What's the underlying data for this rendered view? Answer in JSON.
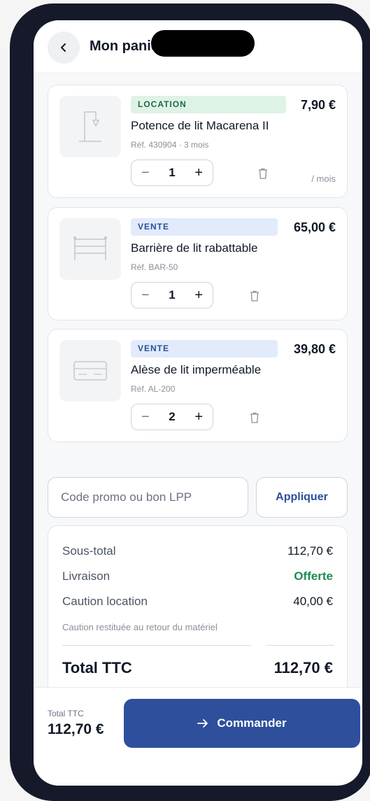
{
  "header": {
    "title": "Mon panier",
    "back_icon": "chevron-left-icon"
  },
  "items": [
    {
      "badge": "LOCATION",
      "badge_type": "location",
      "price": "7,90 €",
      "name": "Potence de lit Macarena II",
      "ref": "Réf. 430904 · 3 mois",
      "qty": "1",
      "period": "/ mois",
      "icon": "bed-pole-icon"
    },
    {
      "badge": "VENTE",
      "badge_type": "vente",
      "price": "65,00 €",
      "name": "Barrière de lit rabattable",
      "ref": "Réf. BAR-50",
      "qty": "1",
      "period": "",
      "icon": "bed-rail-icon"
    },
    {
      "badge": "VENTE",
      "badge_type": "vente",
      "price": "39,80 €",
      "name": "Alèse de lit imperméable",
      "ref": "Réf. AL-200",
      "qty": "2",
      "period": "",
      "icon": "mattress-protector-icon"
    }
  ],
  "promo": {
    "placeholder": "Code promo ou bon LPP",
    "apply_label": "Appliquer"
  },
  "summary": {
    "subtotal_label": "Sous-total",
    "subtotal_value": "112,70 €",
    "delivery_label": "Livraison",
    "delivery_value": "Offerte",
    "deposit_label": "Caution location",
    "deposit_value": "40,00 €",
    "deposit_note": "Caution restituée au retour du matériel",
    "total_label": "Total TTC",
    "total_value": "112,70 €"
  },
  "footer": {
    "total_label": "Total TTC",
    "total_value": "112,70 €",
    "order_label": "Commander",
    "order_icon": "arrow-right-icon"
  },
  "colors": {
    "accent": "#2e4f9c",
    "location_badge_bg": "#def2e6",
    "vente_badge_bg": "#e2ebfb",
    "free_green": "#1f8a52"
  }
}
